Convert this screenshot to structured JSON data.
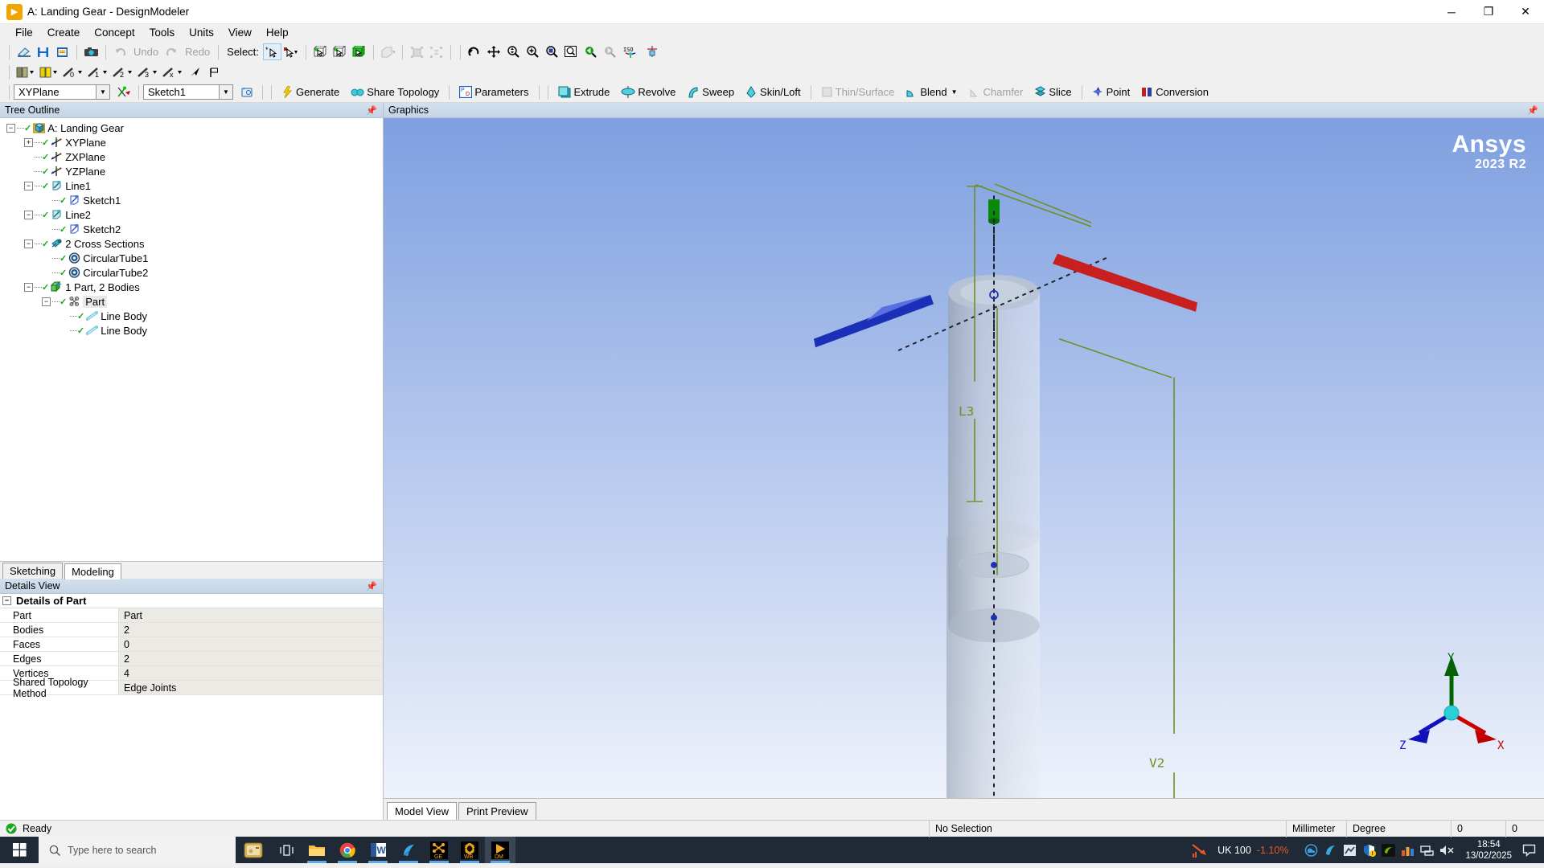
{
  "window": {
    "title": "A: Landing Gear - DesignModeler",
    "app_icon": "designmodeler-icon",
    "minimize": "─",
    "maximize": "❐",
    "close": "✕"
  },
  "menubar": {
    "items": [
      "File",
      "Create",
      "Concept",
      "Tools",
      "Units",
      "View",
      "Help"
    ]
  },
  "toolbar_standard": {
    "select_label": "Select:",
    "undo_label": "Undo",
    "redo_label": "Redo",
    "buttons": [
      "new-icon",
      "save-icon",
      "save-project-icon",
      "screenshot-icon",
      "undo-icon",
      "redo-icon",
      "select-single-icon",
      "select-box-icon",
      "select-bodies-icon",
      "select-faces-icon",
      "select-edges-icon",
      "extend-selection-icon",
      "select-all-icon",
      "deselect-all-icon",
      "rotate-icon",
      "pan-icon",
      "zoom-icon",
      "zoom-in-icon",
      "box-zoom-icon",
      "zoom-to-fit-icon",
      "previous-view-icon",
      "next-view-icon",
      "iso-view-icon",
      "look-at-icon"
    ]
  },
  "toolbar_sketch": {
    "buttons": [
      "new-plane-icon",
      "new-sketch-icon",
      "sketch-dim-0-icon",
      "sketch-dim-1-icon",
      "sketch-dim-2-icon",
      "sketch-dim-3-icon",
      "sketch-dim-x-icon",
      "arrow-icon",
      "flag-icon"
    ]
  },
  "feature_toolbar": {
    "plane_selector": {
      "value": "XYPlane",
      "placeholder": "Plane"
    },
    "sketch_selector": {
      "value": "Sketch1",
      "placeholder": "Sketch"
    },
    "new_plane_icon": "new-plane-icon",
    "new_sketch_icon": "new-sketch-icon",
    "buttons": [
      {
        "label": "Generate",
        "icon": "lightning-icon",
        "enabled": true
      },
      {
        "label": "Share Topology",
        "icon": "share-topology-icon",
        "enabled": true
      },
      {
        "label": "Parameters",
        "icon": "parameters-icon",
        "enabled": true
      },
      {
        "label": "Extrude",
        "icon": "extrude-icon",
        "enabled": true
      },
      {
        "label": "Revolve",
        "icon": "revolve-icon",
        "enabled": true
      },
      {
        "label": "Sweep",
        "icon": "sweep-icon",
        "enabled": true
      },
      {
        "label": "Skin/Loft",
        "icon": "skin-loft-icon",
        "enabled": true
      },
      {
        "label": "Thin/Surface",
        "icon": "thin-surface-icon",
        "enabled": false
      },
      {
        "label": "Blend",
        "icon": "blend-icon",
        "enabled": true,
        "dropdown": true
      },
      {
        "label": "Chamfer",
        "icon": "chamfer-icon",
        "enabled": false
      },
      {
        "label": "Slice",
        "icon": "slice-icon",
        "enabled": true
      },
      {
        "label": "Point",
        "icon": "point-icon",
        "enabled": true
      },
      {
        "label": "Conversion",
        "icon": "conversion-icon",
        "enabled": true
      }
    ]
  },
  "tree_panel": {
    "title": "Tree Outline",
    "pin_icon": "pin-icon",
    "items": [
      {
        "label": "A: Landing Gear",
        "indent": 0,
        "expander": "minus",
        "icon": "project-icon",
        "check": true,
        "selected": false
      },
      {
        "label": "XYPlane",
        "indent": 1,
        "expander": "plus",
        "icon": "plane-icon",
        "check": true,
        "selected": false
      },
      {
        "label": "ZXPlane",
        "indent": 1,
        "expander": "none",
        "icon": "plane-icon",
        "check": true,
        "selected": false
      },
      {
        "label": "YZPlane",
        "indent": 1,
        "expander": "none",
        "icon": "plane-icon",
        "check": true,
        "selected": false
      },
      {
        "label": "Line1",
        "indent": 1,
        "expander": "minus",
        "icon": "line-icon",
        "check": true,
        "selected": false
      },
      {
        "label": "Sketch1",
        "indent": 2,
        "expander": "none",
        "icon": "sketch-icon",
        "check": true,
        "selected": false
      },
      {
        "label": "Line2",
        "indent": 1,
        "expander": "minus",
        "icon": "line-icon",
        "check": true,
        "selected": false
      },
      {
        "label": "Sketch2",
        "indent": 2,
        "expander": "none",
        "icon": "sketch-icon",
        "check": true,
        "selected": false
      },
      {
        "label": "2 Cross Sections",
        "indent": 1,
        "expander": "minus",
        "icon": "cross-section-icon",
        "check": true,
        "selected": false
      },
      {
        "label": "CircularTube1",
        "indent": 2,
        "expander": "none",
        "icon": "circular-tube-icon",
        "check": true,
        "selected": false
      },
      {
        "label": "CircularTube2",
        "indent": 2,
        "expander": "none",
        "icon": "circular-tube-icon",
        "check": true,
        "selected": false
      },
      {
        "label": "1 Part, 2 Bodies",
        "indent": 1,
        "expander": "minus",
        "icon": "bodies-icon",
        "check": true,
        "selected": false
      },
      {
        "label": "Part",
        "indent": 2,
        "expander": "minus",
        "icon": "part-icon",
        "check": true,
        "selected": true
      },
      {
        "label": "Line Body",
        "indent": 3,
        "expander": "none",
        "icon": "line-body-icon",
        "check": true,
        "selected": false
      },
      {
        "label": "Line Body",
        "indent": 3,
        "expander": "none",
        "icon": "line-body-icon",
        "check": true,
        "selected": false
      }
    ]
  },
  "left_tabs": {
    "items": [
      "Sketching",
      "Modeling"
    ],
    "active": "Modeling"
  },
  "details_panel": {
    "title": "Details View",
    "pin_icon": "pin-icon",
    "group_title": "Details of Part",
    "rows": [
      {
        "key": "Part",
        "value": "Part"
      },
      {
        "key": "Bodies",
        "value": "2"
      },
      {
        "key": "Faces",
        "value": "0"
      },
      {
        "key": "Edges",
        "value": "2"
      },
      {
        "key": "Vertices",
        "value": "4"
      },
      {
        "key": "Shared Topology Method",
        "value": "Edge Joints"
      }
    ]
  },
  "graphics_panel": {
    "title": "Graphics",
    "pin_icon": "pin-icon",
    "watermark_brand": "Ansys",
    "watermark_version": "2023 R2",
    "dimension_labels": [
      {
        "name": "L3",
        "text": "L3"
      },
      {
        "name": "V2",
        "text": "V2"
      }
    ],
    "triad": {
      "x_label": "X",
      "y_label": "Y",
      "z_label": "Z",
      "x_color": "#cc0000",
      "y_color": "#006600",
      "z_color": "#0000cc"
    },
    "tabs": {
      "items": [
        "Model View",
        "Print Preview"
      ],
      "active": "Model View"
    }
  },
  "statusbar": {
    "ready_text": "Ready",
    "ready_icon": "ok-icon",
    "selection_text": "No Selection",
    "length_unit": "Millimeter",
    "angle_unit": "Degree",
    "field_a": "0",
    "field_b": "0"
  },
  "taskbar": {
    "start_icon": "windows-icon",
    "search_placeholder": "Type here to search",
    "search_icon": "search-icon",
    "cortana_icon": "cortana-icon",
    "taskview_icon": "task-view-icon",
    "apps": [
      {
        "name": "file-explorer-icon",
        "label": "🗀",
        "open": true,
        "active": false
      },
      {
        "name": "chrome-icon",
        "label": "●",
        "open": true,
        "active": false
      },
      {
        "name": "word-icon",
        "label": "W",
        "open": true,
        "active": false
      },
      {
        "name": "ansys-workbench-launcher-icon",
        "label": "◕",
        "open": true,
        "active": false
      },
      {
        "name": "geometry-editor-icon",
        "label": "GE",
        "open": true,
        "active": false
      },
      {
        "name": "workbench-icon",
        "label": "WB",
        "open": true,
        "active": false
      },
      {
        "name": "designmodeler-icon",
        "label": "DM",
        "open": true,
        "active": true
      }
    ],
    "tray": {
      "stock_label": "UK 100",
      "stock_change": "-1.10%",
      "stock_change_color": "#e05a2b",
      "icons": [
        "onedrive-icon",
        "ansys-icon",
        "edge-icon",
        "security-icon",
        "nvidia-icon",
        "stats-icon",
        "network-icon",
        "volume-muted-icon"
      ],
      "time": "18:54",
      "date": "13/02/2025",
      "action_center_icon": "action-center-icon"
    }
  }
}
